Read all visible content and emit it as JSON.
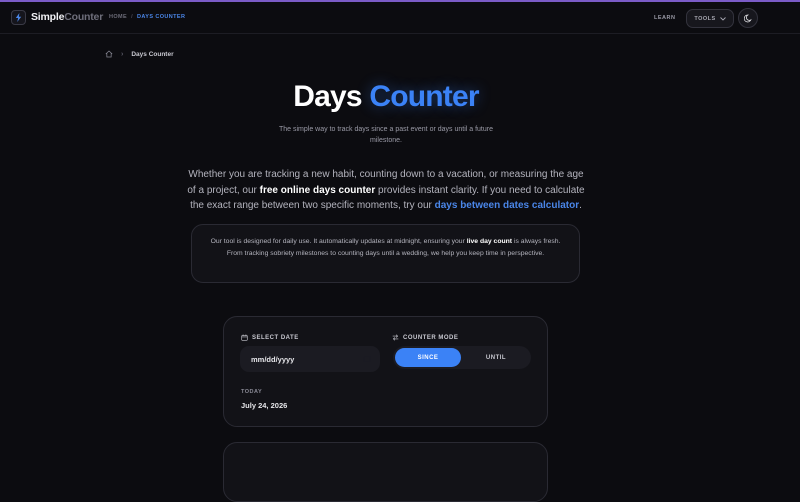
{
  "header": {
    "brand_primary": "Simple",
    "brand_secondary": "Counter",
    "crumb_home": "HOME",
    "crumb_sep": "/",
    "crumb_current": "DAYS COUNTER",
    "learn_label": "LEARN",
    "tools_label": "TOOLS",
    "icons": {
      "logo": "bolt-icon",
      "tools": "chevron-down-icon",
      "theme": "moon-icon"
    },
    "colors": {
      "accent": "#3b82f6",
      "top_line": "#7b5cc7"
    }
  },
  "breadcrumb": {
    "current": "Days Counter",
    "separator": "›",
    "home_icon": "home-icon"
  },
  "hero": {
    "title_part1": "Days",
    "title_part2": "Counter",
    "subtitle": "The simple way to track days since a past event or days until a future milestone."
  },
  "intro": {
    "part1": "Whether you are tracking a new habit, counting down to a vacation, or measuring the age of a project, our ",
    "bold": "free online days counter",
    "part2": " provides instant clarity. If you need to calculate the exact range between two specific moments, try our ",
    "link": "days between dates calculator",
    "part3": "."
  },
  "note": {
    "part1": "Our tool is designed for daily use. It automatically updates at midnight, ensuring your ",
    "bold": "live day count",
    "part2": " is always fresh. From tracking sobriety milestones to counting days until a wedding, we help you keep time in perspective."
  },
  "form": {
    "select_date_label": "SELECT DATE",
    "date_placeholder": "mm/dd/yyyy",
    "counter_mode_label": "COUNTER MODE",
    "modes": [
      "SINCE",
      "UNTIL"
    ],
    "active_mode": "SINCE",
    "today_label": "TODAY",
    "today_value": "July 24, 2026"
  }
}
